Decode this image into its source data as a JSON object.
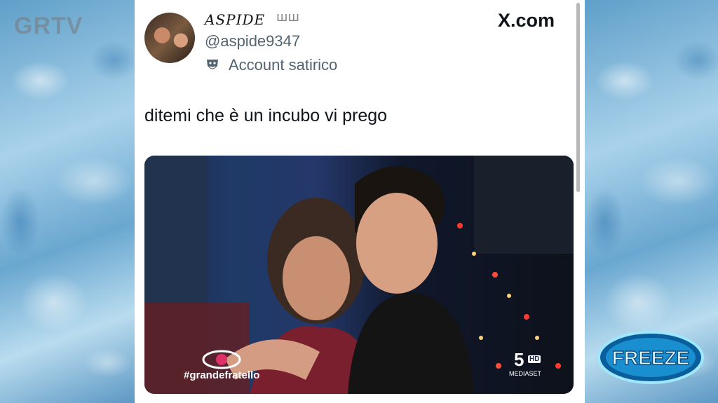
{
  "watermark": "GRTV",
  "tweet": {
    "display_name": "ASPIDE",
    "name_emoji": "ꟺꟺ",
    "handle": "@aspide9347",
    "label": "Account satirico",
    "source": "X.com",
    "text": "ditemi che è un incubo vi prego"
  },
  "media": {
    "hashtag": "#grandefratello",
    "channel_number": "5",
    "channel_badge": "HD",
    "channel_name": "MEDIASET"
  },
  "freeze_logo": "FREEZE",
  "colors": {
    "handle_gray": "#536471",
    "text_dark": "#0f1419",
    "ice_blue": "#8fbfd9"
  }
}
